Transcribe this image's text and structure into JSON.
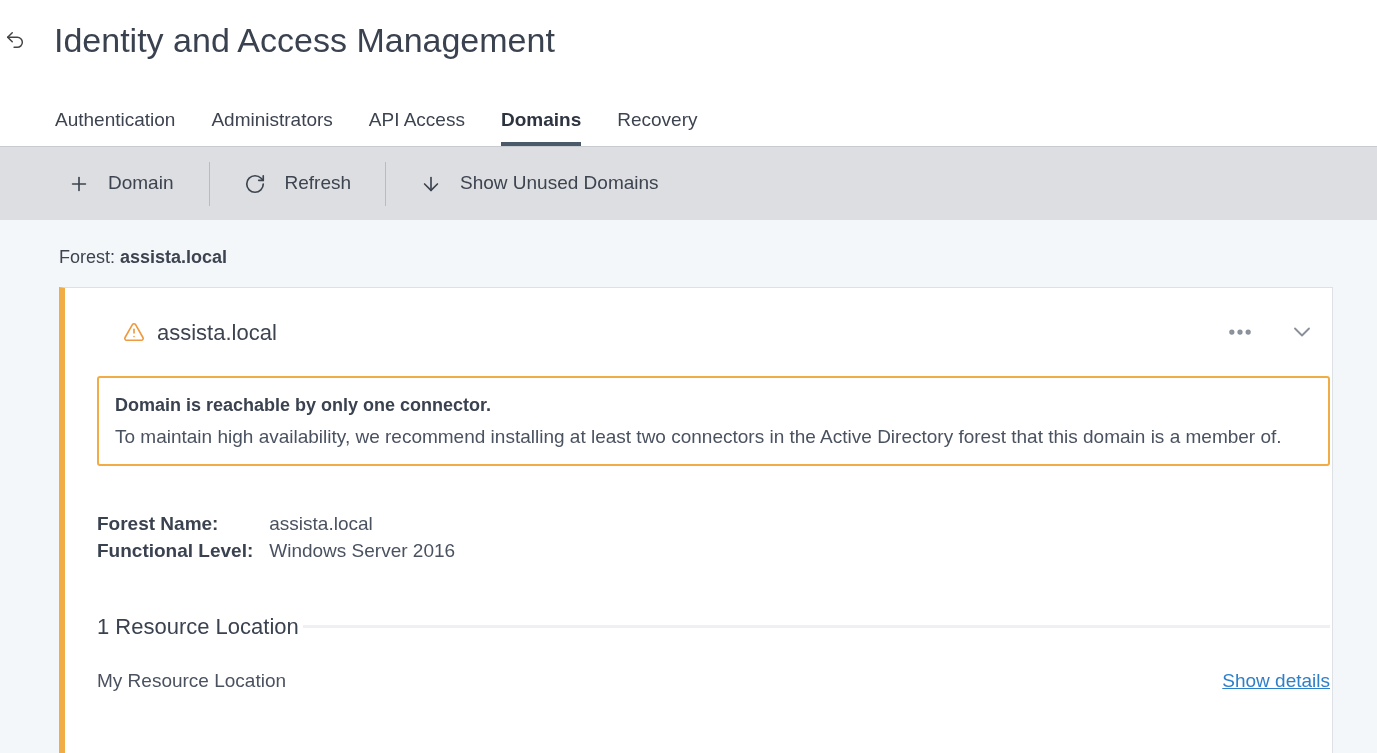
{
  "header": {
    "title": "Identity and Access Management"
  },
  "tabs": [
    {
      "label": "Authentication",
      "selected": false
    },
    {
      "label": "Administrators",
      "selected": false
    },
    {
      "label": "API Access",
      "selected": false
    },
    {
      "label": "Domains",
      "selected": true
    },
    {
      "label": "Recovery",
      "selected": false
    }
  ],
  "toolbar": [
    {
      "kind": "add",
      "label": "Domain"
    },
    {
      "kind": "refresh",
      "label": "Refresh"
    },
    {
      "kind": "download",
      "label": "Show Unused Domains"
    }
  ],
  "forest": {
    "label": "Forest:",
    "name": "assista.local"
  },
  "domain_card": {
    "name": "assista.local",
    "warning": true,
    "expanded": true,
    "alert": {
      "title": "Domain is reachable by only one connector.",
      "message": "To maintain high availability, we recommend installing at least two connectors in the Active Directory forest that this domain is a member of."
    },
    "details": [
      {
        "label": "Forest Name:",
        "value": "assista.local"
      },
      {
        "label": "Functional Level:",
        "value": "Windows Server 2016"
      }
    ],
    "resource_heading": "1 Resource Location",
    "resources": [
      {
        "name": "My Resource Location",
        "link": "Show details"
      }
    ]
  }
}
